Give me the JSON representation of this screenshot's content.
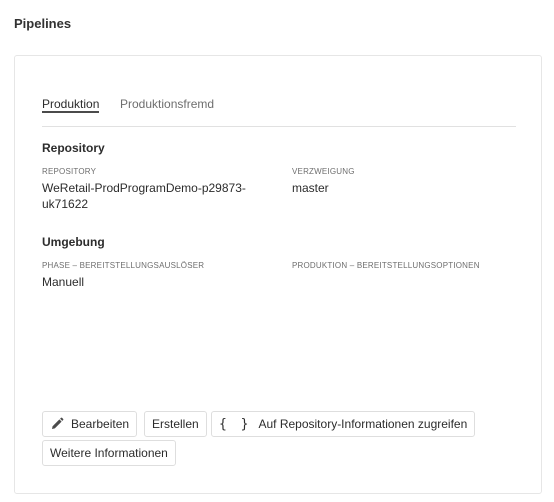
{
  "page": {
    "title": "Pipelines"
  },
  "tabs": [
    {
      "label": "Produktion",
      "active": true
    },
    {
      "label": "Produktionsfremd",
      "active": false
    }
  ],
  "repository": {
    "section_title": "Repository",
    "repo_label": "REPOSITORY",
    "repo_value_line1": "WeRetail-ProdProgramDemo-p29873-",
    "repo_value_line2": "uk71622",
    "branch_label": "VERZWEIGUNG",
    "branch_value": "master"
  },
  "environment": {
    "section_title": "Umgebung",
    "trigger_label": "PHASE – BEREITSTELLUNGSAUSLÖSER",
    "trigger_value": "Manuell",
    "options_label": "PRODUKTION – BEREITSTELLUNGSOPTIONEN"
  },
  "actions": {
    "edit_label": "Bearbeiten",
    "create_label": "Erstellen",
    "repo_info_label": "Auf Repository-Informationen zugreifen",
    "more_info_label": "Weitere Informationen",
    "edit_icon": "pencil-icon",
    "repo_info_icon": "curly-braces-icon",
    "brace_glyph": "{ }"
  }
}
